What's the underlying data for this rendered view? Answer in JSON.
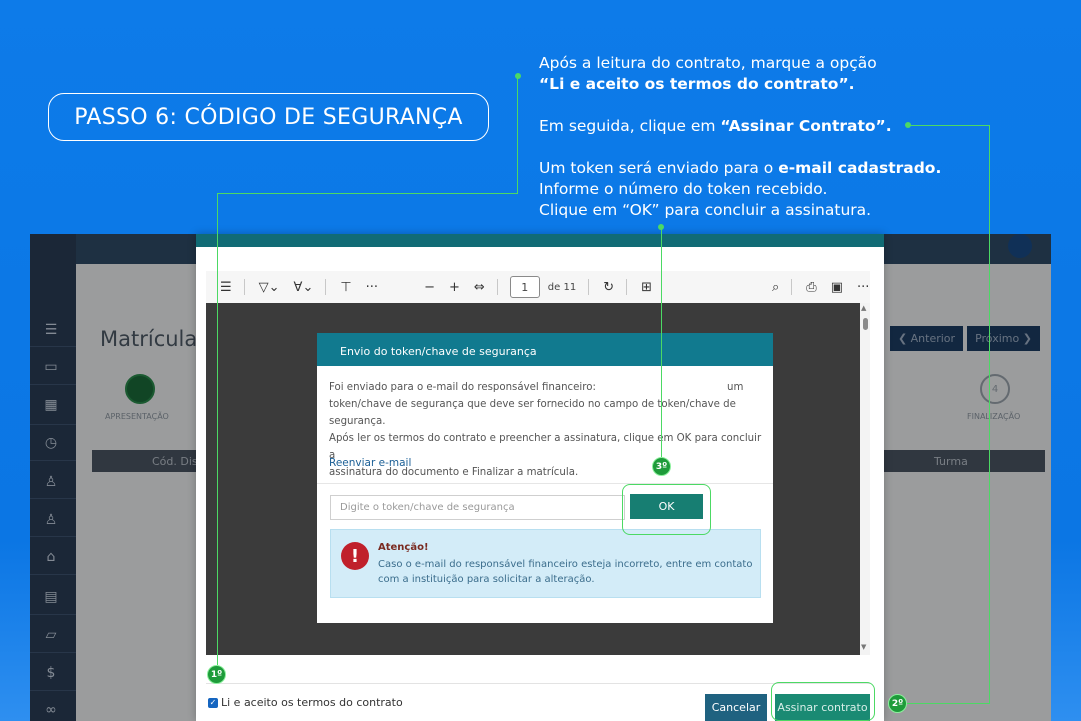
{
  "step_title": "PASSO 6: CÓDIGO DE SEGURANÇA",
  "instructions": {
    "line1": "Após a leitura do contrato, marque a opção",
    "line2": "“Li e aceito os termos do contrato”.",
    "line3_prefix": "Em seguida, clique em ",
    "line3_bold": "“Assinar Contrato”.",
    "line4_prefix": "Um token será enviado para o ",
    "line4_bold": "e-mail cadastrado.",
    "line5": "Informe o número do token recebido.",
    "line6": "Clique em “OK” para concluir a assinatura."
  },
  "background_app": {
    "page_title": "Matrícula",
    "prev_button": "❮ Anterior",
    "next_button": "Próximo ❯",
    "step1_label": "APRESENTAÇÃO",
    "step4_number": "4",
    "step4_label": "FINALIZAÇÃO",
    "table_col1": "Cód. Disc",
    "table_col2": "Turma"
  },
  "pdf_toolbar": {
    "page_current": "1",
    "page_total": "de 11"
  },
  "modal": {
    "header": "Envio do token/chave de segurança",
    "text_line1_start": "Foi enviado para o e-mail do responsável financeiro:",
    "text_line1_end": "um",
    "text_line2": "token/chave de segurança que deve ser fornecido no campo de token/chave de segurança.",
    "text_line3": "Após ler os termos do contrato e preencher a assinatura, clique em OK para concluir a",
    "text_line4": "assinatura do documento e Finalizar a matrícula.",
    "resend_link": "Reenviar e-mail",
    "token_placeholder": "Digite o token/chave de segurança",
    "ok_button": "OK",
    "alert_title": "Atenção!",
    "alert_line1": "Caso o e-mail do responsável financeiro esteja incorreto, entre em contato",
    "alert_line2": "com a instituição para solicitar a alteração."
  },
  "pdf_footer": {
    "accept_label": "Li e aceito os termos do contrato",
    "cancel_button": "Cancelar",
    "sign_button": "Assinar contrato"
  },
  "callouts": {
    "badge1": "1º",
    "badge2": "2º",
    "badge3": "3º"
  },
  "colors": {
    "background": "#0f7ae8",
    "callout_green": "#4cd964",
    "modal_header": "#117a8f",
    "ok_button": "#177e72",
    "sign_button": "#1a8a73",
    "cancel_button": "#1f6280"
  }
}
